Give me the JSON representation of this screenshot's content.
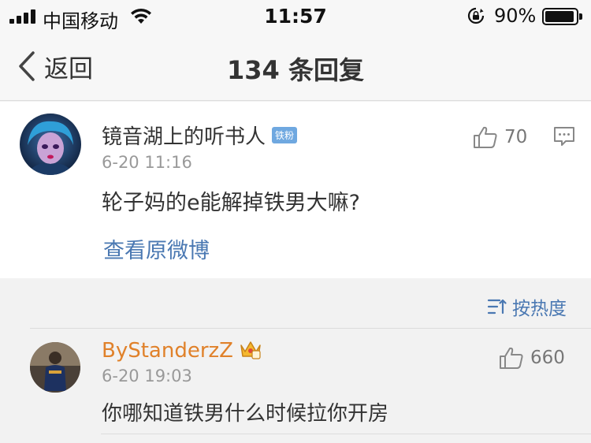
{
  "status_bar": {
    "carrier": "中国移动",
    "time": "11:57",
    "battery_percent": "90%",
    "battery_level": 0.9,
    "icons": [
      "signal-icon",
      "wifi-icon",
      "rotation-lock-icon",
      "battery-icon"
    ]
  },
  "nav": {
    "back_label": "返回",
    "title": "134 条回复"
  },
  "post": {
    "username": "镜音湖上的听书人",
    "badge": "铁粉",
    "timestamp": "6-20 11:16",
    "text": "轮子妈的e能解掉铁男大嘛?",
    "view_original": "查看原微博",
    "like_count": "70"
  },
  "sort": {
    "label": "按热度"
  },
  "reply": {
    "username": "ByStanderzZ",
    "timestamp": "6-20 19:03",
    "text": "你哪知道铁男什么时候拉你开房",
    "like_count": "660"
  },
  "colors": {
    "link_blue": "#4a78b2",
    "reply_username": "#e0812a",
    "badge_blue": "#6fa8e0",
    "background": "#f2f2f2"
  }
}
